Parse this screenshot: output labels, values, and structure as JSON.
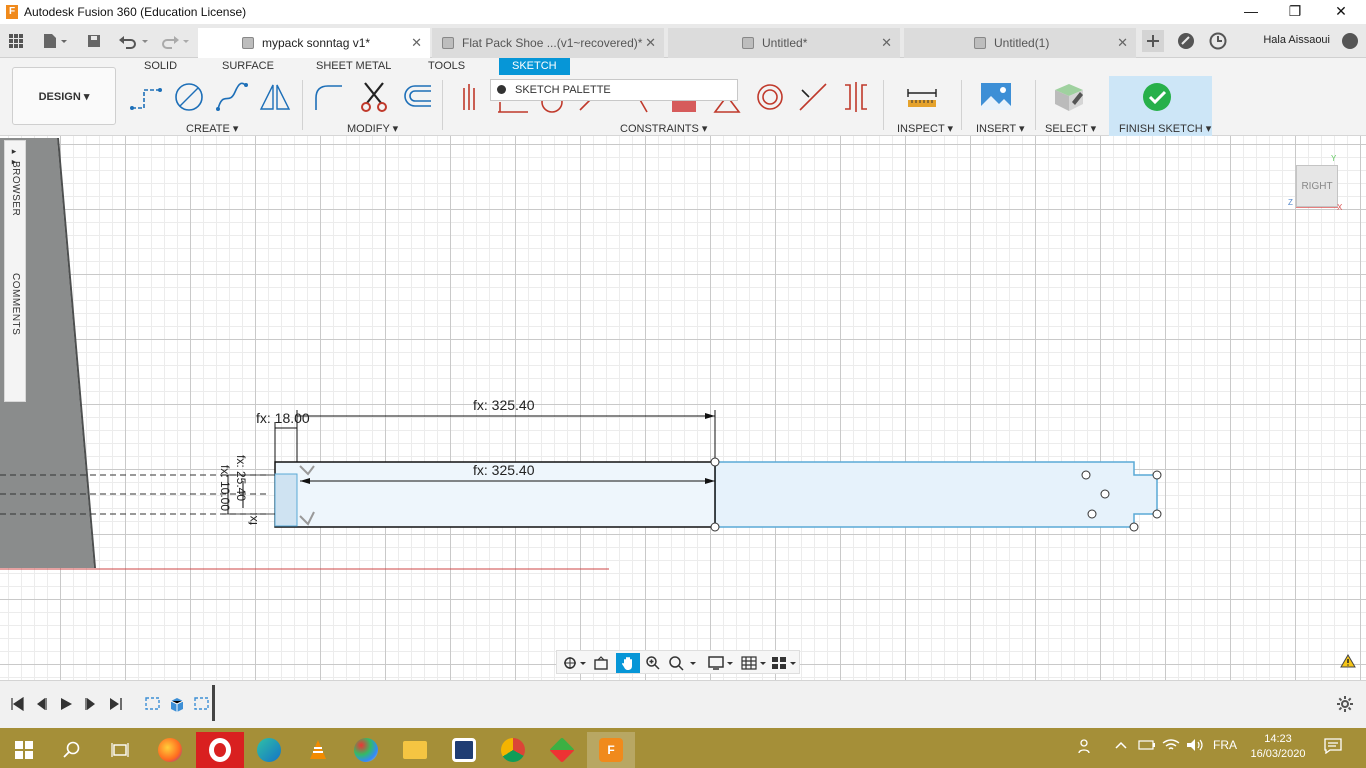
{
  "window": {
    "title": "Autodesk Fusion 360 (Education License)",
    "minimize": "—",
    "maximize": "❐",
    "close": "✕"
  },
  "tabs": [
    {
      "label": "mypack sonntag v1*"
    },
    {
      "label": "Flat Pack Shoe ...(v1~recovered)*"
    },
    {
      "label": "Untitled*"
    },
    {
      "label": "Untitled(1)"
    }
  ],
  "tab_close": "✕",
  "user": {
    "name": "Hala Aissaoui"
  },
  "ribbon": {
    "workspace": "DESIGN ▾",
    "tabs": {
      "solid": "SOLID",
      "surface": "SURFACE",
      "sheet_metal": "SHEET METAL",
      "tools": "TOOLS",
      "sketch": "SKETCH"
    },
    "groups": {
      "create": "CREATE ▾",
      "modify": "MODIFY ▾",
      "constraints": "CONSTRAINTS ▾",
      "inspect": "INSPECT ▾",
      "insert": "INSERT ▾",
      "select": "SELECT ▾",
      "finish_sketch": "FINISH SKETCH ▾"
    },
    "palette": "SKETCH PALETTE"
  },
  "browser": {
    "label": "BROWSER",
    "comments": "COMMENTS",
    "toggle": "▸▸"
  },
  "sketch": {
    "dims": {
      "top_length": "fx: 325.40",
      "inner_length": "fx: 325.40",
      "offset": "fx: 18.00",
      "height": "fx: 25.40",
      "left1": "fx: 10.00",
      "left2": "fx:"
    }
  },
  "viewcube": {
    "face": "RIGHT",
    "axis_y": "Y",
    "axis_z": "Z",
    "axis_x": "X"
  },
  "clock": {
    "time": "14:23",
    "date": "16/03/2020"
  },
  "taskbar": {
    "lang": "FRA"
  },
  "colors": {
    "accent": "#0696d7",
    "taskbar": "#a58f38",
    "fusion_orange": "#f08a1c",
    "sketch_blue": "#5aa9d6"
  }
}
